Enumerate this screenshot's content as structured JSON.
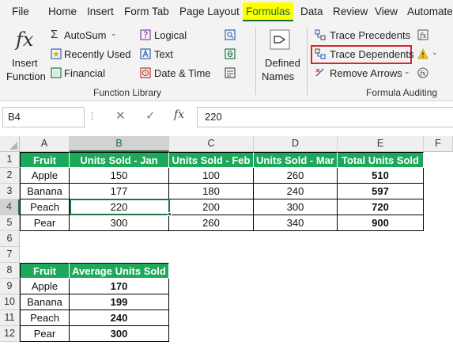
{
  "tabs": [
    "File",
    "Home",
    "Insert",
    "Form Tab",
    "Page Layout",
    "Formulas",
    "Data",
    "Review",
    "View",
    "Automate"
  ],
  "ribbon": {
    "insert_function_line1": "Insert",
    "insert_function_line2": "Function",
    "autosum": "AutoSum",
    "recently_used": "Recently Used",
    "financial": "Financial",
    "logical": "Logical",
    "text": "Text",
    "date_time": "Date & Time",
    "defined_names_line1": "Defined",
    "defined_names_line2": "Names",
    "function_library_label": "Function Library",
    "trace_precedents": "Trace Precedents",
    "trace_dependents": "Trace Dependents",
    "remove_arrows": "Remove Arrows",
    "formula_auditing_label": "Formula Auditing",
    "highlight_color": "#d9262c",
    "active_tab_bg": "#ffff00"
  },
  "formula_bar": {
    "name_box": "B4",
    "fx": "fx",
    "value": "220"
  },
  "grid": {
    "columns": [
      "A",
      "B",
      "C",
      "D",
      "E",
      "F"
    ],
    "rows": [
      "1",
      "2",
      "3",
      "4",
      "5",
      "6",
      "7",
      "8",
      "9",
      "10",
      "11",
      "12"
    ],
    "header_color": "#1ea85a"
  },
  "table1": {
    "headers": [
      "Fruit",
      "Units Sold - Jan",
      "Units Sold - Feb",
      "Units Sold - Mar",
      "Total Units Sold"
    ],
    "rows": [
      [
        "Apple",
        "150",
        "100",
        "260",
        "510"
      ],
      [
        "Banana",
        "177",
        "180",
        "240",
        "597"
      ],
      [
        "Peach",
        "220",
        "200",
        "300",
        "720"
      ],
      [
        "Pear",
        "300",
        "260",
        "340",
        "900"
      ]
    ]
  },
  "table2": {
    "headers": [
      "Fruit",
      "Average Units Sold"
    ],
    "rows": [
      [
        "Apple",
        "170"
      ],
      [
        "Banana",
        "199"
      ],
      [
        "Peach",
        "240"
      ],
      [
        "Pear",
        "300"
      ]
    ]
  }
}
